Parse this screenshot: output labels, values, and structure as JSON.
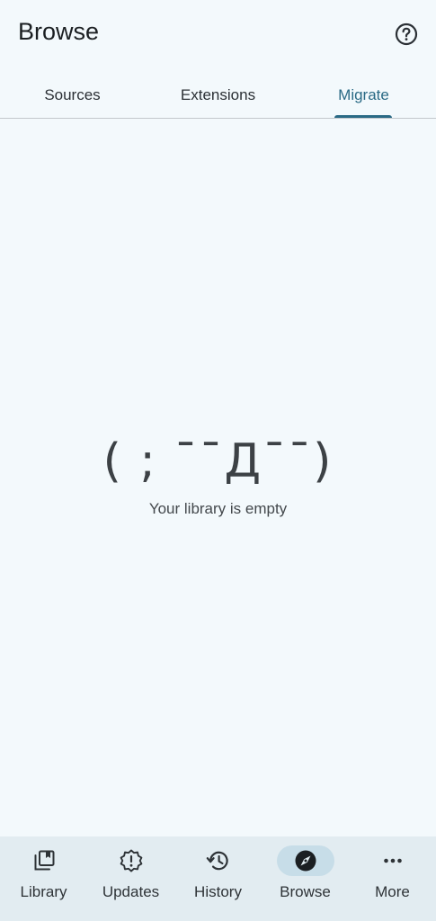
{
  "header": {
    "title": "Browse",
    "help_icon": "help-circle-icon"
  },
  "tabs": [
    {
      "label": "Sources",
      "active": false
    },
    {
      "label": "Extensions",
      "active": false
    },
    {
      "label": "Migrate",
      "active": true
    }
  ],
  "empty_state": {
    "kaomoji": "( ; ¯¯Д¯¯)",
    "message": "Your library is empty"
  },
  "bottom_nav": [
    {
      "label": "Library",
      "icon": "library-icon",
      "active": false
    },
    {
      "label": "Updates",
      "icon": "updates-icon",
      "active": false
    },
    {
      "label": "History",
      "icon": "history-icon",
      "active": false
    },
    {
      "label": "Browse",
      "icon": "compass-icon",
      "active": true
    },
    {
      "label": "More",
      "icon": "more-horizontal-icon",
      "active": false
    }
  ],
  "colors": {
    "background": "#f3f9fc",
    "accent": "#2a6a85",
    "nav_background": "#e2ecf1",
    "nav_active_pill": "#c7dde8"
  }
}
